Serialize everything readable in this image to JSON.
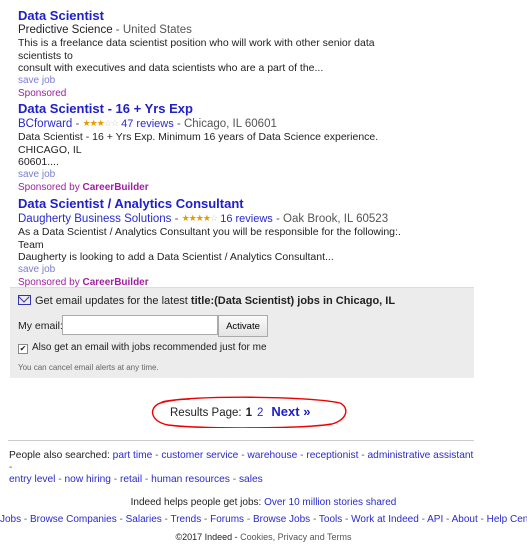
{
  "jobs": [
    {
      "title": "Data Scientist",
      "company": "Predictive Science",
      "location": "United States",
      "snippet1": "This is a freelance data scientist position who will work with other senior data scientists to",
      "snippet2": "consult with executives and data scientists who are a part of the...",
      "save": "save job",
      "sponsored": "Sponsored",
      "sponsor_name": ""
    },
    {
      "title": "Data Scientist - 16 + Yrs Exp",
      "company": "BCforward",
      "rating": 3,
      "reviews": "47 reviews",
      "location": "Chicago, IL 60601",
      "snippet1": "Data Scientist - 16 + Yrs Exp. Minimum 16 years of Data Science experience. CHICAGO, IL",
      "snippet2": "60601....",
      "save": "save job",
      "sponsored": "Sponsored by",
      "sponsor_name": "CareerBuilder"
    },
    {
      "title": "Data Scientist / Analytics Consultant",
      "company": "Daugherty Business Solutions",
      "rating": 4,
      "reviews": "16 reviews",
      "location": "Oak Brook, IL 60523",
      "snippet1": "As a Data Scientist / Analytics Consultant you will be responsible for the following:. Team",
      "snippet2": "Daugherty is looking to add a Data Scientist / Analytics Consultant...",
      "save": "save job",
      "sponsored": "Sponsored by",
      "sponsor_name": "CareerBuilder"
    }
  ],
  "alert": {
    "head_prefix": "Get email updates for the latest ",
    "head_bold": "title:(Data Scientist) jobs in Chicago, IL",
    "email_label": "My email:",
    "email_value": "",
    "activate": "Activate",
    "also_label": "Also get an email with jobs recommended just for me",
    "cancel_note": "You can cancel email alerts at any time."
  },
  "pager": {
    "label": "Results Page:",
    "current": "1",
    "page2": "2",
    "next": "Next »"
  },
  "also_searched": {
    "label": "People also searched:",
    "items": [
      "part time",
      "customer service",
      "warehouse",
      "receptionist",
      "administrative assistant",
      "entry level",
      "now hiring",
      "retail",
      "human resources",
      "sales"
    ]
  },
  "helps": {
    "text": "Indeed helps people get jobs: ",
    "link": "Over 10 million stories shared"
  },
  "footer": {
    "links": [
      "Jobs",
      "Browse Companies",
      "Salaries",
      "Trends",
      "Forums",
      "Browse Jobs",
      "Tools",
      "Work at Indeed",
      "API",
      "About",
      "Help Center"
    ]
  },
  "copyright": {
    "text": "©2017 Indeed - ",
    "link": "Cookies, Privacy and Terms"
  }
}
